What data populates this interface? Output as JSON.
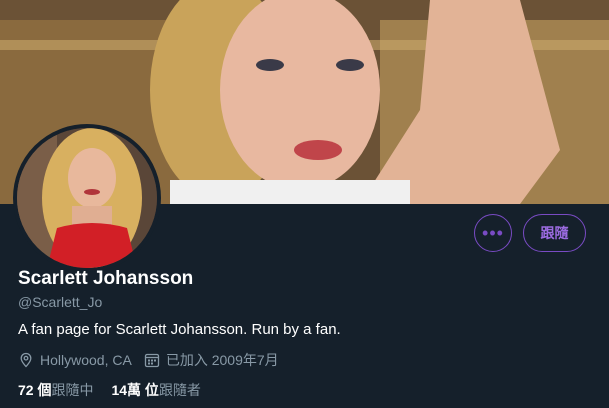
{
  "profile": {
    "name": "Scarlett Johansson",
    "handle": "@Scarlett_Jo",
    "bio": "A fan page for Scarlett Johansson. Run by a fan.",
    "location": "Hollywood, CA",
    "joined": "已加入 2009年7月"
  },
  "actions": {
    "more_label": "•••",
    "follow_label": "跟隨"
  },
  "stats": {
    "following_count": "72 個",
    "following_label": "跟隨中",
    "followers_count": "14萬 位",
    "followers_label": "跟隨者"
  },
  "icons": {
    "location": "location-pin-icon",
    "calendar": "calendar-icon"
  },
  "colors": {
    "background": "#15202b",
    "accent": "#794bc4",
    "secondary_text": "#8899a6"
  }
}
